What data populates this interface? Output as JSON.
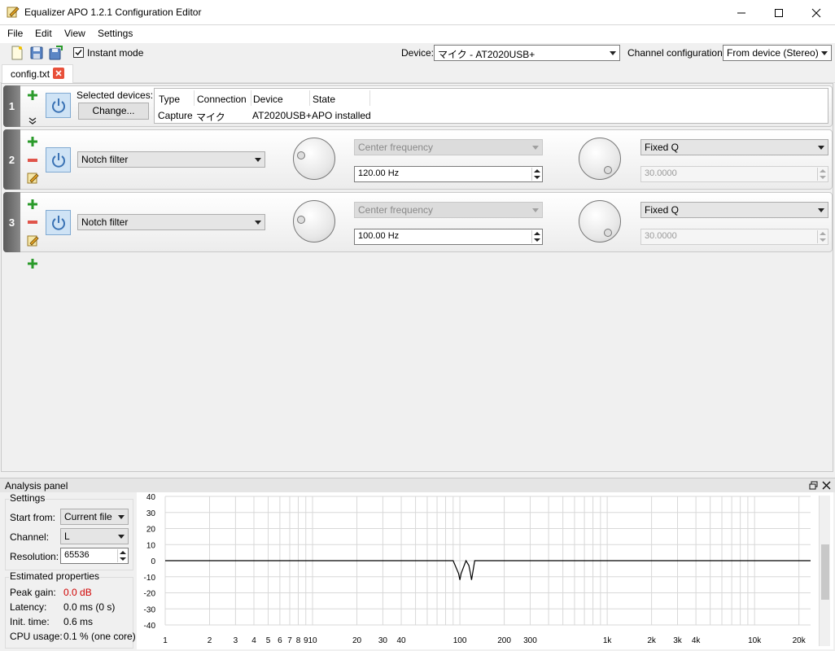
{
  "window": {
    "title": "Equalizer APO 1.2.1 Configuration Editor"
  },
  "menu": [
    "File",
    "Edit",
    "View",
    "Settings"
  ],
  "toolbar": {
    "instant_mode_label": "Instant mode",
    "instant_mode_checked": true,
    "device_label": "Device:",
    "device_value": "マイク - AT2020USB+",
    "channel_config_label": "Channel configuration:",
    "channel_config_value": "From device (Stereo)"
  },
  "tab": {
    "label": "config.txt"
  },
  "device_row": {
    "number": "1",
    "selected_devices_label": "Selected devices:",
    "change_button": "Change...",
    "table": {
      "headers": [
        "Type",
        "Connection",
        "Device",
        "State"
      ],
      "row": [
        "Capture",
        "マイク",
        "AT2020USB+",
        "APO installed"
      ]
    }
  },
  "filters": [
    {
      "number": "2",
      "type": "Notch filter",
      "param_mode": "Center frequency",
      "freq": "120.00 Hz",
      "q_mode": "Fixed Q",
      "q_value": "30.0000"
    },
    {
      "number": "3",
      "type": "Notch filter",
      "param_mode": "Center frequency",
      "freq": "100.00 Hz",
      "q_mode": "Fixed Q",
      "q_value": "30.0000"
    }
  ],
  "analysis": {
    "title": "Analysis panel",
    "settings_label": "Settings",
    "start_from_label": "Start from:",
    "start_from_value": "Current file",
    "channel_label": "Channel:",
    "channel_value": "L",
    "resolution_label": "Resolution:",
    "resolution_value": "65536",
    "estimated_label": "Estimated properties",
    "peak_gain_label": "Peak gain:",
    "peak_gain_value": "0.0 dB",
    "latency_label": "Latency:",
    "latency_value": "0.0 ms (0 s)",
    "init_time_label": "Init. time:",
    "init_time_value": "0.6 ms",
    "cpu_label": "CPU usage:",
    "cpu_value": "0.1 % (one core)",
    "peak_color": "#d00000"
  },
  "chart_data": {
    "type": "line",
    "x_scale": "log",
    "xlim": [
      1,
      24000
    ],
    "ylim": [
      -40,
      40
    ],
    "y_ticks": [
      "40",
      "30",
      "20",
      "10",
      "0",
      "-10",
      "-20",
      "-30",
      "-40"
    ],
    "x_ticks": [
      "1",
      "2",
      "3",
      "4",
      "5",
      "6",
      "7",
      "8",
      "9",
      "10",
      "20",
      "30",
      "40",
      "100",
      "200",
      "300",
      "1k",
      "2k",
      "3k",
      "4k",
      "10k",
      "20k"
    ],
    "series": [
      {
        "x": [
          1,
          90,
          98,
          100,
          102,
          110,
          115,
          118,
          120,
          122,
          126,
          24000
        ],
        "y": [
          0,
          0,
          -8,
          -12,
          -8,
          0,
          -3,
          -8,
          -12,
          -8,
          0,
          0
        ]
      }
    ],
    "grid": true
  }
}
